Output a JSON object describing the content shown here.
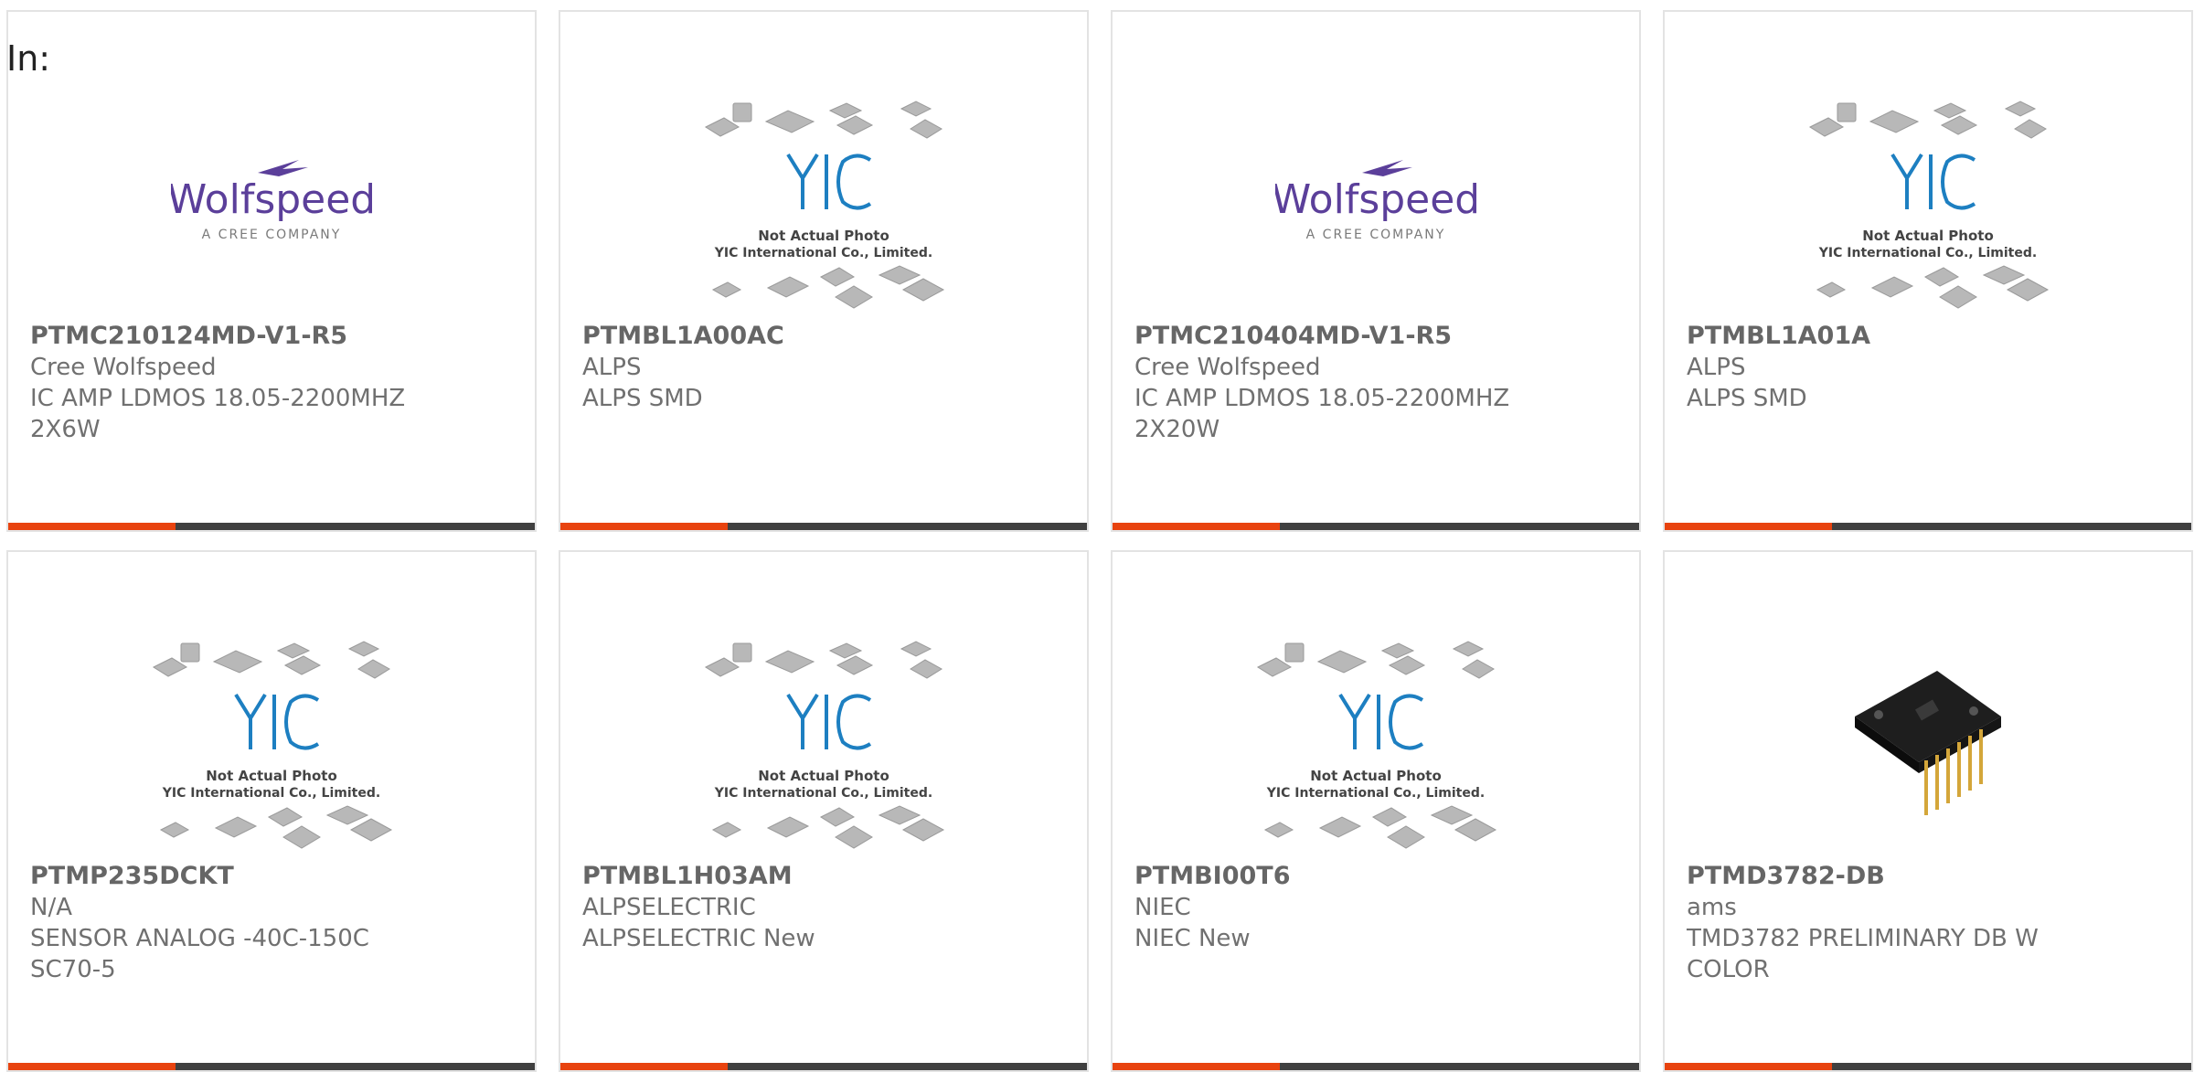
{
  "page": {
    "label": "In:"
  },
  "colors": {
    "accent": "#e8430f",
    "bar": "#404040",
    "wolfspeed": "#5b3f9a",
    "yic_blue": "#1d7fc1"
  },
  "placeholders": {
    "yic_line1": "Not Actual Photo",
    "yic_line2": "YIC International Co., Limited."
  },
  "logos": {
    "wolfspeed_word": "Wolfspeed",
    "wolfspeed_sub": "A CREE COMPANY"
  },
  "cards": [
    {
      "image": "wolfspeed-logo",
      "part": "PTMC210124MD-V1-R5",
      "manufacturer": "Cree Wolfspeed",
      "desc1": "IC AMP LDMOS 18.05-2200MHZ",
      "desc2": "2X6W"
    },
    {
      "image": "yic-placeholder",
      "part": "PTMBL1A00AC",
      "manufacturer": "ALPS",
      "desc1": "ALPS SMD",
      "desc2": ""
    },
    {
      "image": "wolfspeed-logo",
      "part": "PTMC210404MD-V1-R5",
      "manufacturer": "Cree Wolfspeed",
      "desc1": "IC AMP LDMOS 18.05-2200MHZ",
      "desc2": "2X20W"
    },
    {
      "image": "yic-placeholder",
      "part": "PTMBL1A01A",
      "manufacturer": "ALPS",
      "desc1": "ALPS SMD",
      "desc2": ""
    },
    {
      "image": "yic-placeholder",
      "part": "PTMP235DCKT",
      "manufacturer": "N/A",
      "desc1": "SENSOR ANALOG -40C-150C",
      "desc2": "SC70-5"
    },
    {
      "image": "yic-placeholder",
      "part": "PTMBL1H03AM",
      "manufacturer": "ALPSELECTRIC",
      "desc1": "ALPSELECTRIC New",
      "desc2": ""
    },
    {
      "image": "yic-placeholder",
      "part": "PTMBI00T6",
      "manufacturer": "NIEC",
      "desc1": "NIEC New",
      "desc2": ""
    },
    {
      "image": "sensor-board-photo",
      "part": "PTMD3782-DB",
      "manufacturer": "ams",
      "desc1": "TMD3782 PRELIMINARY DB W",
      "desc2": "COLOR"
    }
  ]
}
